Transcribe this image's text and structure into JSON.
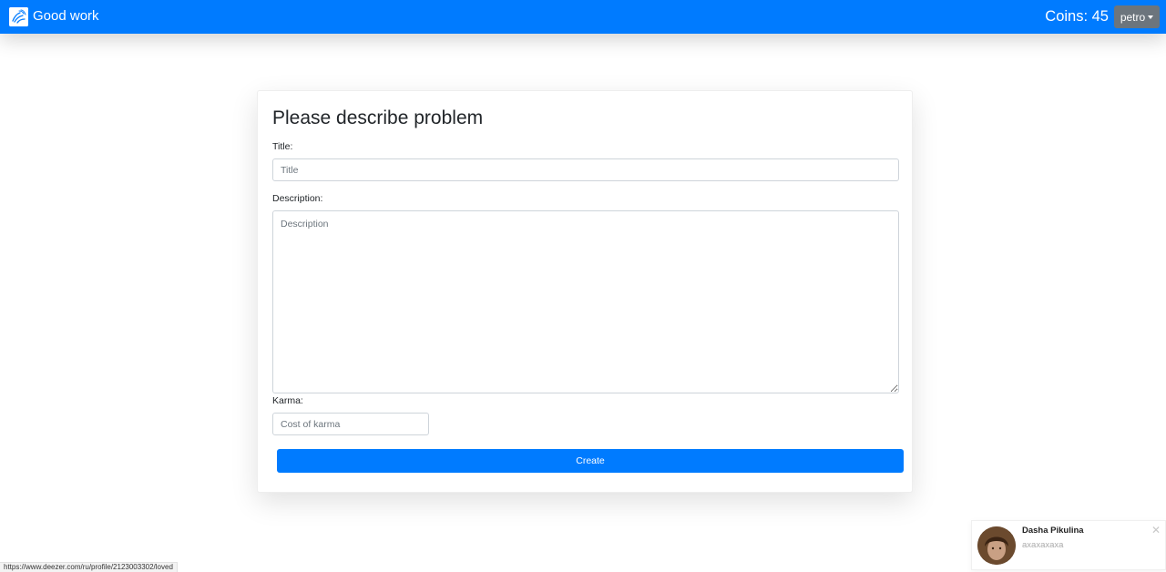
{
  "navbar": {
    "brand_text": "Good work",
    "brand_icon": "logo-icon",
    "coins_text": "Coins: 45",
    "user_label": "petro",
    "background_color": "#007bff"
  },
  "form": {
    "heading": "Please describe problem",
    "title_label": "Title:",
    "title_placeholder": "Title",
    "title_value": "",
    "description_label": "Description:",
    "description_placeholder": "Description",
    "description_value": "",
    "karma_label": "Karma:",
    "karma_placeholder": "Cost of karma",
    "karma_value": "",
    "create_button": "Create"
  },
  "toast": {
    "name": "Dasha Pikulina",
    "message": "axaxaxaxa",
    "close_icon": "close-icon"
  },
  "status_bar": {
    "url": "https://www.deezer.com/ru/profile/2123003302/loved"
  }
}
